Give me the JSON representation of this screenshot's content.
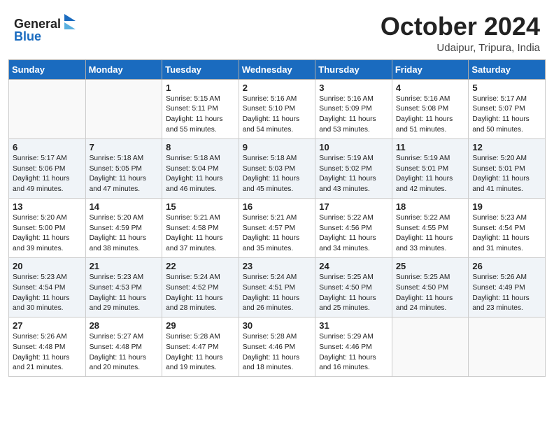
{
  "header": {
    "logo_line1": "General",
    "logo_line2": "Blue",
    "month": "October 2024",
    "location": "Udaipur, Tripura, India"
  },
  "weekdays": [
    "Sunday",
    "Monday",
    "Tuesday",
    "Wednesday",
    "Thursday",
    "Friday",
    "Saturday"
  ],
  "weeks": [
    [
      {
        "day": "",
        "sunrise": "",
        "sunset": "",
        "daylight": ""
      },
      {
        "day": "",
        "sunrise": "",
        "sunset": "",
        "daylight": ""
      },
      {
        "day": "1",
        "sunrise": "Sunrise: 5:15 AM",
        "sunset": "Sunset: 5:11 PM",
        "daylight": "Daylight: 11 hours and 55 minutes."
      },
      {
        "day": "2",
        "sunrise": "Sunrise: 5:16 AM",
        "sunset": "Sunset: 5:10 PM",
        "daylight": "Daylight: 11 hours and 54 minutes."
      },
      {
        "day": "3",
        "sunrise": "Sunrise: 5:16 AM",
        "sunset": "Sunset: 5:09 PM",
        "daylight": "Daylight: 11 hours and 53 minutes."
      },
      {
        "day": "4",
        "sunrise": "Sunrise: 5:16 AM",
        "sunset": "Sunset: 5:08 PM",
        "daylight": "Daylight: 11 hours and 51 minutes."
      },
      {
        "day": "5",
        "sunrise": "Sunrise: 5:17 AM",
        "sunset": "Sunset: 5:07 PM",
        "daylight": "Daylight: 11 hours and 50 minutes."
      }
    ],
    [
      {
        "day": "6",
        "sunrise": "Sunrise: 5:17 AM",
        "sunset": "Sunset: 5:06 PM",
        "daylight": "Daylight: 11 hours and 49 minutes."
      },
      {
        "day": "7",
        "sunrise": "Sunrise: 5:18 AM",
        "sunset": "Sunset: 5:05 PM",
        "daylight": "Daylight: 11 hours and 47 minutes."
      },
      {
        "day": "8",
        "sunrise": "Sunrise: 5:18 AM",
        "sunset": "Sunset: 5:04 PM",
        "daylight": "Daylight: 11 hours and 46 minutes."
      },
      {
        "day": "9",
        "sunrise": "Sunrise: 5:18 AM",
        "sunset": "Sunset: 5:03 PM",
        "daylight": "Daylight: 11 hours and 45 minutes."
      },
      {
        "day": "10",
        "sunrise": "Sunrise: 5:19 AM",
        "sunset": "Sunset: 5:02 PM",
        "daylight": "Daylight: 11 hours and 43 minutes."
      },
      {
        "day": "11",
        "sunrise": "Sunrise: 5:19 AM",
        "sunset": "Sunset: 5:01 PM",
        "daylight": "Daylight: 11 hours and 42 minutes."
      },
      {
        "day": "12",
        "sunrise": "Sunrise: 5:20 AM",
        "sunset": "Sunset: 5:01 PM",
        "daylight": "Daylight: 11 hours and 41 minutes."
      }
    ],
    [
      {
        "day": "13",
        "sunrise": "Sunrise: 5:20 AM",
        "sunset": "Sunset: 5:00 PM",
        "daylight": "Daylight: 11 hours and 39 minutes."
      },
      {
        "day": "14",
        "sunrise": "Sunrise: 5:20 AM",
        "sunset": "Sunset: 4:59 PM",
        "daylight": "Daylight: 11 hours and 38 minutes."
      },
      {
        "day": "15",
        "sunrise": "Sunrise: 5:21 AM",
        "sunset": "Sunset: 4:58 PM",
        "daylight": "Daylight: 11 hours and 37 minutes."
      },
      {
        "day": "16",
        "sunrise": "Sunrise: 5:21 AM",
        "sunset": "Sunset: 4:57 PM",
        "daylight": "Daylight: 11 hours and 35 minutes."
      },
      {
        "day": "17",
        "sunrise": "Sunrise: 5:22 AM",
        "sunset": "Sunset: 4:56 PM",
        "daylight": "Daylight: 11 hours and 34 minutes."
      },
      {
        "day": "18",
        "sunrise": "Sunrise: 5:22 AM",
        "sunset": "Sunset: 4:55 PM",
        "daylight": "Daylight: 11 hours and 33 minutes."
      },
      {
        "day": "19",
        "sunrise": "Sunrise: 5:23 AM",
        "sunset": "Sunset: 4:54 PM",
        "daylight": "Daylight: 11 hours and 31 minutes."
      }
    ],
    [
      {
        "day": "20",
        "sunrise": "Sunrise: 5:23 AM",
        "sunset": "Sunset: 4:54 PM",
        "daylight": "Daylight: 11 hours and 30 minutes."
      },
      {
        "day": "21",
        "sunrise": "Sunrise: 5:23 AM",
        "sunset": "Sunset: 4:53 PM",
        "daylight": "Daylight: 11 hours and 29 minutes."
      },
      {
        "day": "22",
        "sunrise": "Sunrise: 5:24 AM",
        "sunset": "Sunset: 4:52 PM",
        "daylight": "Daylight: 11 hours and 28 minutes."
      },
      {
        "day": "23",
        "sunrise": "Sunrise: 5:24 AM",
        "sunset": "Sunset: 4:51 PM",
        "daylight": "Daylight: 11 hours and 26 minutes."
      },
      {
        "day": "24",
        "sunrise": "Sunrise: 5:25 AM",
        "sunset": "Sunset: 4:50 PM",
        "daylight": "Daylight: 11 hours and 25 minutes."
      },
      {
        "day": "25",
        "sunrise": "Sunrise: 5:25 AM",
        "sunset": "Sunset: 4:50 PM",
        "daylight": "Daylight: 11 hours and 24 minutes."
      },
      {
        "day": "26",
        "sunrise": "Sunrise: 5:26 AM",
        "sunset": "Sunset: 4:49 PM",
        "daylight": "Daylight: 11 hours and 23 minutes."
      }
    ],
    [
      {
        "day": "27",
        "sunrise": "Sunrise: 5:26 AM",
        "sunset": "Sunset: 4:48 PM",
        "daylight": "Daylight: 11 hours and 21 minutes."
      },
      {
        "day": "28",
        "sunrise": "Sunrise: 5:27 AM",
        "sunset": "Sunset: 4:48 PM",
        "daylight": "Daylight: 11 hours and 20 minutes."
      },
      {
        "day": "29",
        "sunrise": "Sunrise: 5:28 AM",
        "sunset": "Sunset: 4:47 PM",
        "daylight": "Daylight: 11 hours and 19 minutes."
      },
      {
        "day": "30",
        "sunrise": "Sunrise: 5:28 AM",
        "sunset": "Sunset: 4:46 PM",
        "daylight": "Daylight: 11 hours and 18 minutes."
      },
      {
        "day": "31",
        "sunrise": "Sunrise: 5:29 AM",
        "sunset": "Sunset: 4:46 PM",
        "daylight": "Daylight: 11 hours and 16 minutes."
      },
      {
        "day": "",
        "sunrise": "",
        "sunset": "",
        "daylight": ""
      },
      {
        "day": "",
        "sunrise": "",
        "sunset": "",
        "daylight": ""
      }
    ]
  ]
}
